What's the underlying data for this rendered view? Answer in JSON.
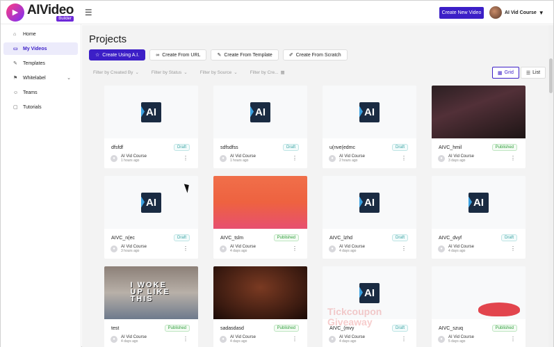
{
  "app": {
    "logo_name": "AIVideo",
    "logo_sub": "Builder",
    "menu_icon": "hamburger-icon"
  },
  "header": {
    "create_button": "Create New Video",
    "user_name": "AI Vid Course"
  },
  "sidebar": {
    "items": [
      {
        "label": "Home",
        "icon": "home-icon"
      },
      {
        "label": "My Videos",
        "icon": "video-icon"
      },
      {
        "label": "Templates",
        "icon": "template-icon"
      },
      {
        "label": "Whitelabel",
        "icon": "whitelabel-icon"
      },
      {
        "label": "Teams",
        "icon": "team-icon"
      },
      {
        "label": "Tutorials",
        "icon": "tutorial-icon"
      }
    ]
  },
  "main": {
    "title": "Projects",
    "actions": [
      {
        "label": "Create Using A.I."
      },
      {
        "label": "Create From URL"
      },
      {
        "label": "Create From Template"
      },
      {
        "label": "Create From Scratch"
      }
    ],
    "filters": [
      {
        "label": "Filter by Created By"
      },
      {
        "label": "Filter by Status"
      },
      {
        "label": "Filter by Source"
      },
      {
        "label": "Filter by Cre..."
      }
    ],
    "view": {
      "grid": "Grid",
      "list": "List"
    }
  },
  "projects": [
    {
      "name": "dfsfdf",
      "status": "Draft",
      "owner": "AI Vid Course",
      "time": "1 hours ago",
      "thumb_text": "AI"
    },
    {
      "name": "sdfsdfss",
      "status": "Draft",
      "owner": "AI Vid Course",
      "time": "1 hours ago",
      "thumb_text": "AI"
    },
    {
      "name": "u(nve(edmc",
      "status": "Draft",
      "owner": "AI Vid Course",
      "time": "2 hours ago",
      "thumb_text": "AI"
    },
    {
      "name": "AIVC_hmil",
      "status": "Published",
      "owner": "AI Vid Course",
      "time": "3 days ago",
      "thumb_text": ""
    },
    {
      "name": "AIVC_n(ec",
      "status": "Draft",
      "owner": "AI Vid Course",
      "time": "3 hours ago",
      "thumb_text": "AI"
    },
    {
      "name": "AIVC_tslm",
      "status": "Published",
      "owner": "AI Vid Course",
      "time": "4 days ago",
      "thumb_text": ""
    },
    {
      "name": "AIVC_lzhd",
      "status": "Draft",
      "owner": "AI Vid Course",
      "time": "4 days ago",
      "thumb_text": "AI"
    },
    {
      "name": "AIVC_dvyf",
      "status": "Draft",
      "owner": "AI Vid Course",
      "time": "4 days ago",
      "thumb_text": "AI"
    },
    {
      "name": "test",
      "status": "Published",
      "owner": "AI Vid Course",
      "time": "4 days ago",
      "thumb_text": "I WOKE UP LIKE THIS"
    },
    {
      "name": "sadasdasd",
      "status": "Published",
      "owner": "AI Vid Course",
      "time": "4 days ago",
      "thumb_text": ""
    },
    {
      "name": "AIVC_(mvy",
      "status": "Draft",
      "owner": "AI Vid Course",
      "time": "4 days ago",
      "thumb_text": "AI"
    },
    {
      "name": "AIVC_szuq",
      "status": "Published",
      "owner": "AI Vid Course",
      "time": "5 days ago",
      "thumb_text": ""
    }
  ],
  "watermark": {
    "line1": "Tickcoupon",
    "line2": "Giveaway"
  }
}
